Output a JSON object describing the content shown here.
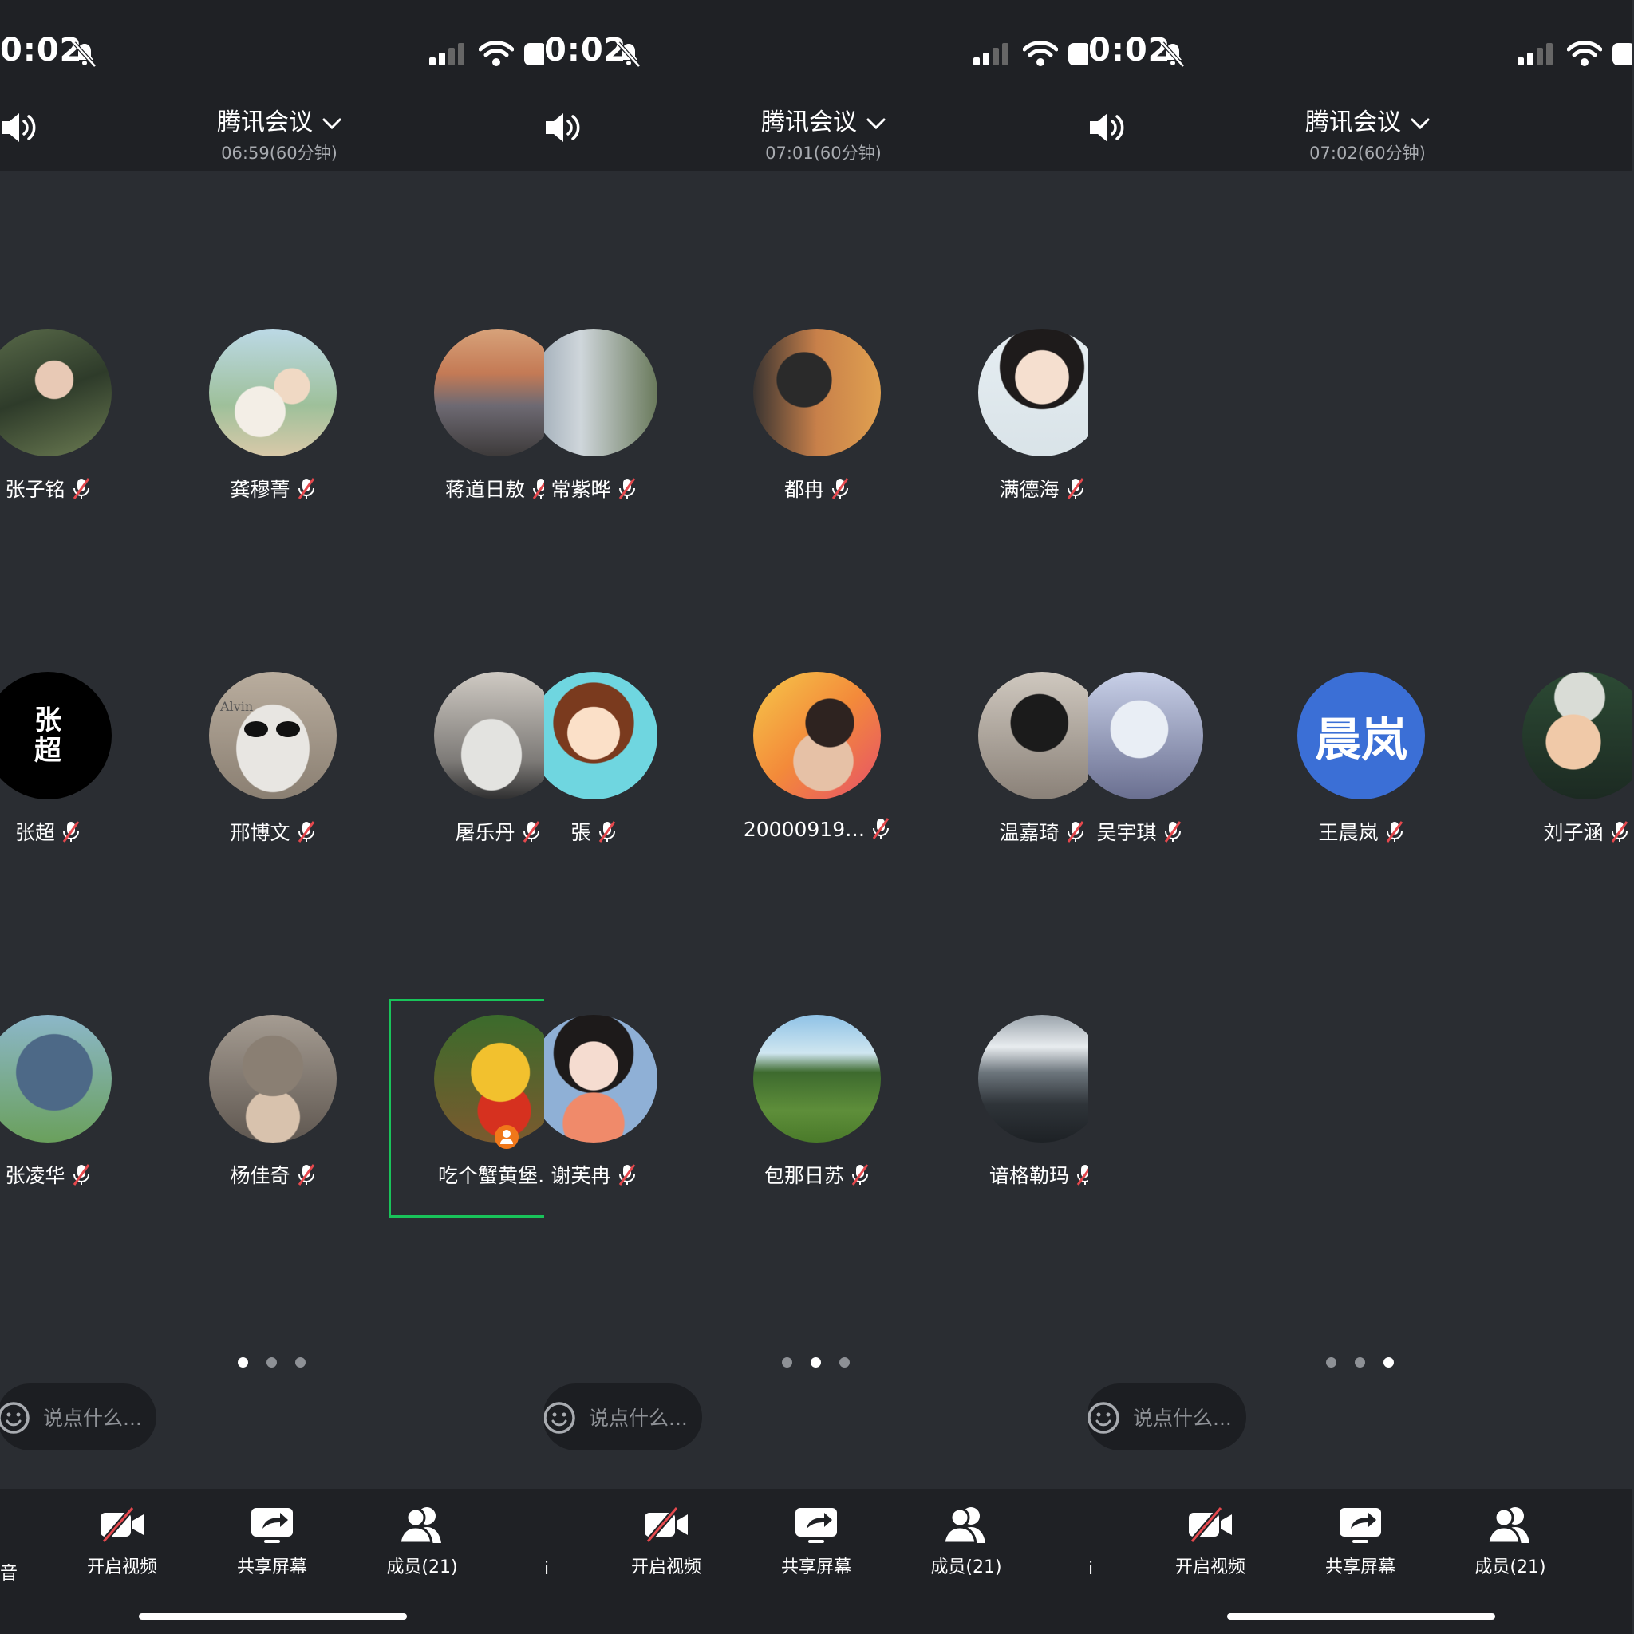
{
  "status_bar": {
    "time": "0:02"
  },
  "header": {
    "title": "腾讯会议"
  },
  "screens": [
    {
      "subtitle": "06:59(60分钟)",
      "active_page": 1
    },
    {
      "subtitle": "07:01(60分钟)",
      "active_page": 2
    },
    {
      "subtitle": "07:02(60分钟)",
      "active_page": 3
    }
  ],
  "participants": [
    {
      "name": "张子铭",
      "muted": true
    },
    {
      "name": "龚穆菁",
      "muted": true
    },
    {
      "name": "蒋道日敖",
      "muted": true
    },
    {
      "name": "常紫晔",
      "muted": true
    },
    {
      "name": "都冉",
      "muted": true
    },
    {
      "name": "满德海",
      "muted": true
    },
    {
      "name": "张超",
      "muted": true
    },
    {
      "name": "邢博文",
      "muted": true
    },
    {
      "name": "屠乐丹",
      "muted": true
    },
    {
      "name": "張",
      "muted": true
    },
    {
      "name": "20000919…",
      "muted": true
    },
    {
      "name": "温嘉琦",
      "muted": true
    },
    {
      "name": "吴宇琪",
      "muted": true
    },
    {
      "name": "王晨岚",
      "muted": true,
      "avatar_text": "晨岚",
      "avatar_color": "#3b6fd6"
    },
    {
      "name": "刘子涵",
      "muted": true
    },
    {
      "name": "张凌华",
      "muted": true
    },
    {
      "name": "杨佳奇",
      "muted": true
    },
    {
      "name": "吃个蟹黄堡…",
      "muted": false,
      "is_host": true
    },
    {
      "name": "谢芙冉",
      "muted": true
    },
    {
      "name": "包那日苏",
      "muted": true
    },
    {
      "name": "谙格勒玛",
      "muted": true
    }
  ],
  "avatar_texts": {
    "zhangchao": "张\n超"
  },
  "avatar_watermark": "Alvin",
  "chat": {
    "placeholder": "说点什么..."
  },
  "toolbar": {
    "video_label": "开启视频",
    "share_label": "共享屏幕",
    "members_label": "成员(21)"
  },
  "edge_chars": {
    "p0": "音",
    "p1": "i",
    "p2": "i"
  },
  "colors": {
    "bg": "#2a2d32",
    "bar": "#1f2125",
    "speaker_highlight": "#19c35a",
    "muted_mic": "#e5484d",
    "host_badge": "#f0771a"
  }
}
